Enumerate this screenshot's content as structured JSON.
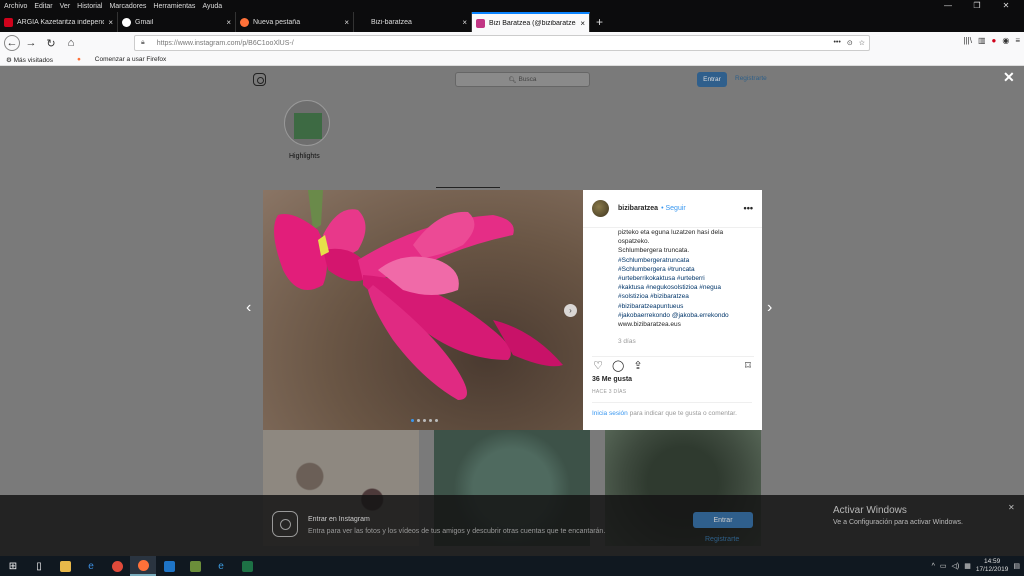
{
  "menubar": {
    "items": [
      "Archivo",
      "Editar",
      "Ver",
      "Historial",
      "Marcadores",
      "Herramientas",
      "Ayuda"
    ]
  },
  "window_controls": {
    "min": "—",
    "max": "❐",
    "close": "✕"
  },
  "tabs": [
    {
      "title": "ARGIA Kazetaritza independent",
      "favicon_color": "#d0021b"
    },
    {
      "title": "Gmail",
      "favicon_color": "#ffffff"
    },
    {
      "title": "Nueva pestaña",
      "favicon_color": "#ff7139"
    },
    {
      "title": "Bizi-baratzea",
      "favicon_color": ""
    },
    {
      "title": "Bizi Baratzea (@bizibaratzea) -",
      "favicon_color": "#c13584"
    }
  ],
  "tab_close": "×",
  "new_tab": "+",
  "nav": {
    "back": "←",
    "forward": "→",
    "reload": "↻",
    "home": "⌂"
  },
  "urlbar": {
    "url": "https://www.instagram.com/p/B6C1ooXlUS-/",
    "page_actions": "•••",
    "reader": "⊙",
    "bookmark": "☆"
  },
  "toolbar_right": {
    "library": "|||\\",
    "sidebar": "▥",
    "menu": "≡"
  },
  "bookmarks": {
    "item1": "Más visitados",
    "item2": "Comenzar a usar Firefox"
  },
  "ig": {
    "search_placeholder": "Busca",
    "login": "Entrar",
    "register": "Registrarte",
    "close": "✕",
    "highlights_label": "Highlights"
  },
  "post": {
    "username": "bizibaratzea",
    "follow": "Seguir",
    "more": "•••",
    "caption_lines": [
      "pizteko eta eguna luzatzen hasi dela",
      "ospatzeko.",
      "Schlumbergera truncata."
    ],
    "hashtags": [
      "#Schlumbergeratruncata",
      "#Schlumbergera #truncata",
      "#urteberrikokaktusa #urteberri",
      "#kaktusa #negukosolstizioa #negua",
      "#solstizioa #bizibaratzea",
      "#bizibaratzeapuntueus",
      "#jakobaerrekondo @jakoba.errekondo"
    ],
    "website": "www.bizibaratzea.eus",
    "time_ago": "3 días",
    "likes": "36 Me gusta",
    "date": "HACE 3 DÍAS",
    "login_link": "Inicia sesión",
    "login_prompt": " para indicar que te gusta o comentar.",
    "prev_arrow": "‹",
    "next_arrow": "›",
    "img_next": "›"
  },
  "banner": {
    "title": "Entrar en Instagram",
    "subtitle": "Entra para ver las fotos y los vídeos de tus amigos y descubrir otras cuentas que te encantarán.",
    "login": "Entrar",
    "register": "Registrarte",
    "close": "✕"
  },
  "windows_activation": {
    "title": "Activar Windows",
    "subtitle": "Ve a Configuración para activar Windows."
  },
  "taskbar": {
    "time": "14:59",
    "date": "17/12/2019",
    "tray_up": "^"
  }
}
